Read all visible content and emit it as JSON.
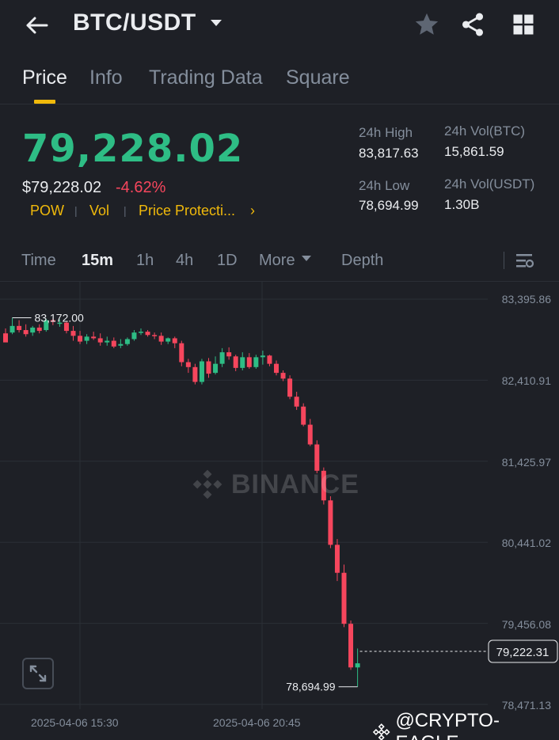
{
  "header": {
    "title": "BTC/USDT",
    "back_icon": "arrow-left-icon",
    "favorite_icon": "star-icon",
    "share_icon": "share-icon",
    "more_icon": "grid-icon"
  },
  "tabs": [
    {
      "label": "Price",
      "active": true
    },
    {
      "label": "Info",
      "active": false
    },
    {
      "label": "Trading Data",
      "active": false
    },
    {
      "label": "Square",
      "active": false
    }
  ],
  "ticker": {
    "last_price": "79,228.02",
    "usd_price": "$79,228.02",
    "change_pct": "-4.62%",
    "tags": [
      "POW",
      "Vol",
      "Price Protecti..."
    ],
    "tags_chevron": "›",
    "stats": {
      "high_label": "24h High",
      "high_value": "83,817.63",
      "low_label": "24h Low",
      "low_value": "78,694.99",
      "vol_btc_label": "24h Vol(BTC)",
      "vol_btc_value": "15,861.59",
      "vol_usdt_label": "24h Vol(USDT)",
      "vol_usdt_value": "1.30B"
    }
  },
  "intervals": {
    "time": "Time",
    "m15": "15m",
    "h1": "1h",
    "h4": "4h",
    "d1": "1D",
    "more": "More",
    "depth": "Depth",
    "active": "15m"
  },
  "colors": {
    "up": "#2ebd85",
    "down": "#f6465d",
    "accent": "#f0b90b",
    "background": "#1e2026"
  },
  "chart": {
    "watermark": "BINANCE",
    "max_marker": "83,172.00",
    "min_marker": "78,694.99",
    "current_price_tag": "79,222.31",
    "credit": "@CRYPTO-EAGLE",
    "expand_icon": "expand-icon"
  },
  "chart_data": {
    "type": "candlestick",
    "interval": "15m",
    "price_ticks": [
      "83,395.86",
      "82,410.91",
      "81,425.97",
      "80,441.02",
      "79,456.08",
      "78,471.13"
    ],
    "price_tick_values": [
      83395.86,
      82410.91,
      81425.97,
      80441.02,
      79456.08,
      78471.13
    ],
    "time_ticks": [
      "2025-04-06 15:30",
      "2025-04-06 20:45"
    ],
    "candles": [
      [
        82990,
        83050,
        82890,
        82880
      ],
      [
        83000,
        83180,
        82980,
        83080
      ],
      [
        83080,
        83150,
        83000,
        83030
      ],
      [
        83030,
        83100,
        82950,
        82980
      ],
      [
        83000,
        83080,
        82960,
        83060
      ],
      [
        83060,
        83100,
        82990,
        83020
      ],
      [
        83030,
        83170,
        83010,
        83150
      ],
      [
        83150,
        83172,
        83090,
        83130
      ],
      [
        83120,
        83160,
        83070,
        83120
      ],
      [
        83120,
        83140,
        82990,
        83020
      ],
      [
        83020,
        83080,
        82900,
        82960
      ],
      [
        82960,
        83020,
        82860,
        82890
      ],
      [
        82900,
        82980,
        82860,
        82950
      ],
      [
        82950,
        83010,
        82910,
        82930
      ],
      [
        82930,
        82990,
        82840,
        82880
      ],
      [
        82880,
        82950,
        82840,
        82900
      ],
      [
        82900,
        82940,
        82810,
        82830
      ],
      [
        82840,
        82920,
        82810,
        82860
      ],
      [
        82860,
        82940,
        82840,
        82920
      ],
      [
        82920,
        83030,
        82900,
        83000
      ],
      [
        83000,
        83050,
        82970,
        83010
      ],
      [
        83010,
        83030,
        82950,
        82970
      ],
      [
        82970,
        83000,
        82920,
        82960
      ],
      [
        82960,
        83000,
        82850,
        82890
      ],
      [
        82890,
        82940,
        82860,
        82930
      ],
      [
        82930,
        82950,
        82810,
        82870
      ],
      [
        82870,
        82900,
        82590,
        82640
      ],
      [
        82640,
        82680,
        82510,
        82580
      ],
      [
        82580,
        82620,
        82370,
        82400
      ],
      [
        82400,
        82680,
        82370,
        82650
      ],
      [
        82650,
        82690,
        82450,
        82500
      ],
      [
        82510,
        82710,
        82490,
        82620
      ],
      [
        82620,
        82810,
        82580,
        82760
      ],
      [
        82760,
        82820,
        82670,
        82710
      ],
      [
        82710,
        82730,
        82530,
        82570
      ],
      [
        82570,
        82760,
        82540,
        82700
      ],
      [
        82700,
        82750,
        82560,
        82580
      ],
      [
        82580,
        82730,
        82560,
        82700
      ],
      [
        82700,
        82780,
        82610,
        82720
      ],
      [
        82720,
        82730,
        82590,
        82620
      ],
      [
        82620,
        82660,
        82480,
        82510
      ],
      [
        82510,
        82540,
        82410,
        82440
      ],
      [
        82440,
        82480,
        82190,
        82220
      ],
      [
        82220,
        82280,
        82060,
        82100
      ],
      [
        82100,
        82140,
        81860,
        81880
      ],
      [
        81880,
        81950,
        81620,
        81640
      ],
      [
        81640,
        81690,
        81290,
        81320
      ],
      [
        81320,
        81360,
        80910,
        80960
      ],
      [
        80960,
        81010,
        80380,
        80420
      ],
      [
        80420,
        80490,
        79980,
        80080
      ],
      [
        80080,
        80180,
        79420,
        79460
      ],
      [
        79460,
        79500,
        78900,
        78930
      ],
      [
        78930,
        79160,
        78694.99,
        78980
      ]
    ]
  }
}
